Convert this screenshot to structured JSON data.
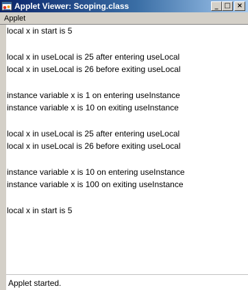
{
  "window": {
    "title": "Applet Viewer: Scoping.class",
    "buttons": {
      "minimize": "_",
      "maximize": "□",
      "close": "×"
    }
  },
  "menu": {
    "items": [
      "Applet"
    ]
  },
  "output": {
    "lines": [
      "local x in start is 5",
      "local x in useLocal is 25 after entering useLocal",
      "local x in useLocal is 26 before exiting useLocal",
      "instance variable x is 1 on entering useInstance",
      "instance variable x is 10 on exiting useInstance",
      "local x in useLocal is 25 after entering useLocal",
      "local x in useLocal is 26 before exiting useLocal",
      "instance variable x is 10 on entering useInstance",
      "instance variable x is 100 on exiting useInstance",
      "local x in start is 5"
    ]
  },
  "status": {
    "text": "Applet started."
  },
  "colors": {
    "titlebar_start": "#0a246a",
    "titlebar_end": "#a6caf0",
    "chrome": "#d4d0c8",
    "content_bg": "#ffffff"
  }
}
